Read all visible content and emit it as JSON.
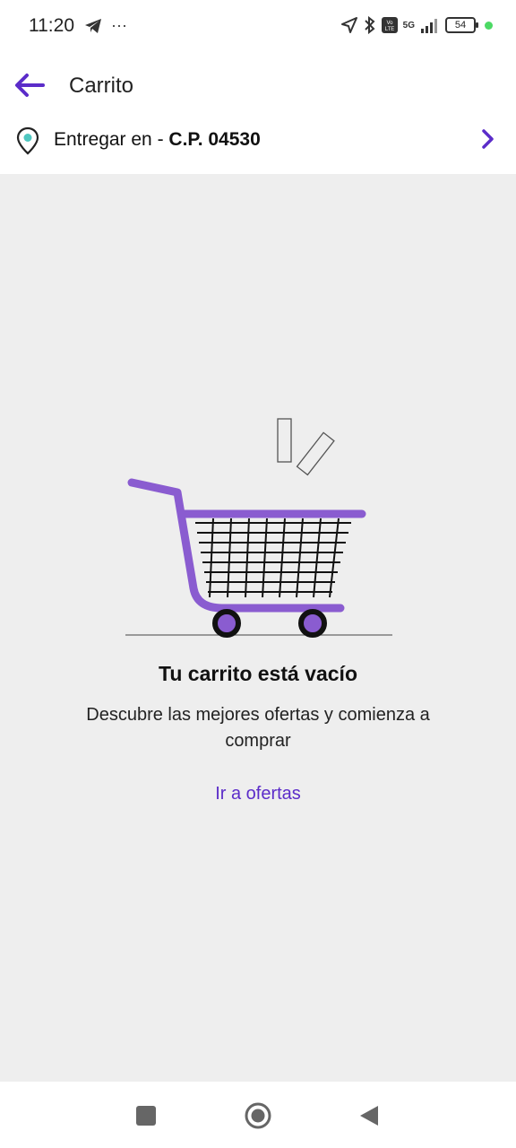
{
  "status_bar": {
    "time": "11:20",
    "dots": "···",
    "network": "5G",
    "battery": "54"
  },
  "header": {
    "title": "Carrito",
    "back_icon": "arrow-left-icon"
  },
  "delivery": {
    "prefix": "Entregar en - ",
    "postal_code": "C.P. 04530",
    "icon": "location-pin-icon"
  },
  "empty_state": {
    "title": "Tu carrito está vacío",
    "subtitle": "Descubre las mejores ofertas y comienza a comprar",
    "cta": "Ir a ofertas",
    "illustration": "shopping-cart-illustration"
  },
  "colors": {
    "accent": "#5b2cc9",
    "cart_purple": "#8a5cd0",
    "background": "#eeeeee"
  }
}
